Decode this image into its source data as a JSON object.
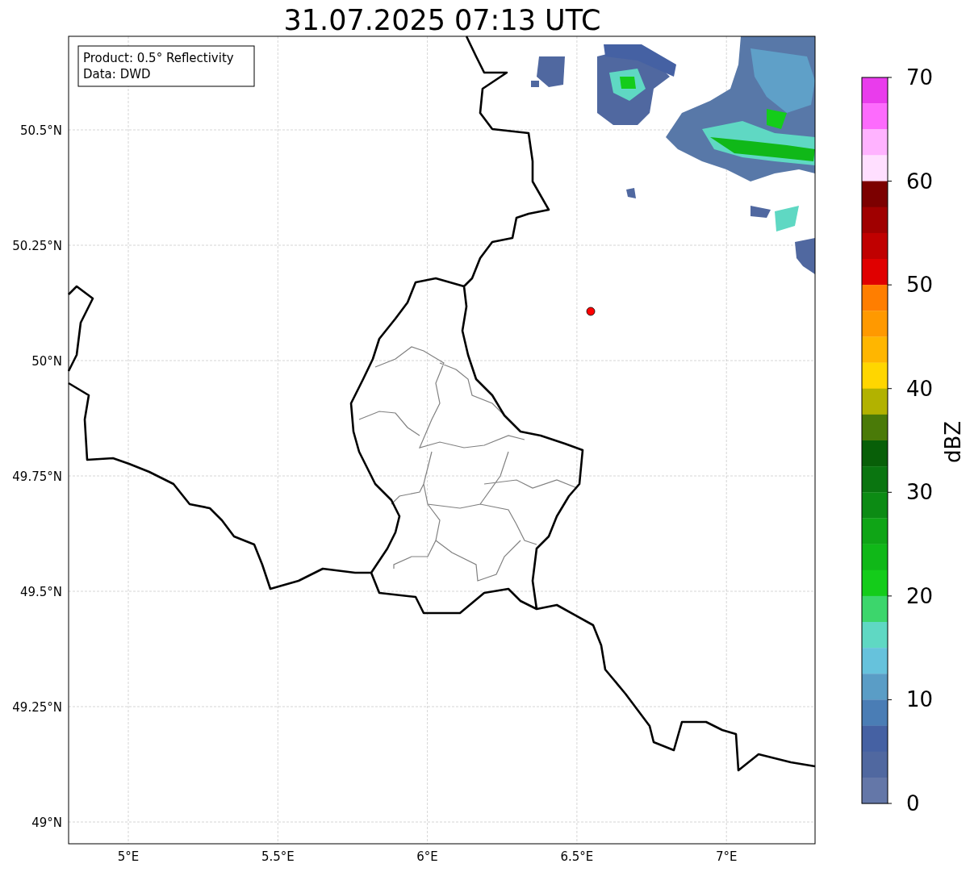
{
  "title": "31.07.2025 07:13 UTC",
  "info_box": [
    "Product: 0.5° Reflectivity",
    "Data: DWD"
  ],
  "map": {
    "lat_labels": [
      "50.5°N",
      "50.25°N",
      "50°N",
      "49.75°N",
      "49.5°N",
      "49.25°N",
      "49°N"
    ],
    "lon_labels": [
      "5°E",
      "5.5°E",
      "6°E",
      "6.5°E",
      "7°E"
    ]
  },
  "colorbar": {
    "label": "dBZ",
    "ticks": [
      "70",
      "60",
      "50",
      "40",
      "30",
      "20",
      "10",
      "0"
    ],
    "bins": [
      {
        "color": "#e93cec"
      },
      {
        "color": "#fd6bfd"
      },
      {
        "color": "#ffb3ff"
      },
      {
        "color": "#ffdfff"
      },
      {
        "color": "#7c0000"
      },
      {
        "color": "#a00000"
      },
      {
        "color": "#c00000"
      },
      {
        "color": "#e00000"
      },
      {
        "color": "#ff7e00"
      },
      {
        "color": "#ff9900"
      },
      {
        "color": "#ffb600"
      },
      {
        "color": "#ffd600"
      },
      {
        "color": "#b2b200"
      },
      {
        "color": "#4a7a08"
      },
      {
        "color": "#085f08"
      },
      {
        "color": "#0a7510"
      },
      {
        "color": "#0c8b14"
      },
      {
        "color": "#0fa516"
      },
      {
        "color": "#10b818"
      },
      {
        "color": "#14cc1a"
      },
      {
        "color": "#3cd66c"
      },
      {
        "color": "#5fd8c3"
      },
      {
        "color": "#66c2dc"
      },
      {
        "color": "#5a9dc6"
      },
      {
        "color": "#4a7db5"
      },
      {
        "color": "#4561a3"
      },
      {
        "color": "#5068a0"
      },
      {
        "color": "#6477a8"
      }
    ]
  }
}
